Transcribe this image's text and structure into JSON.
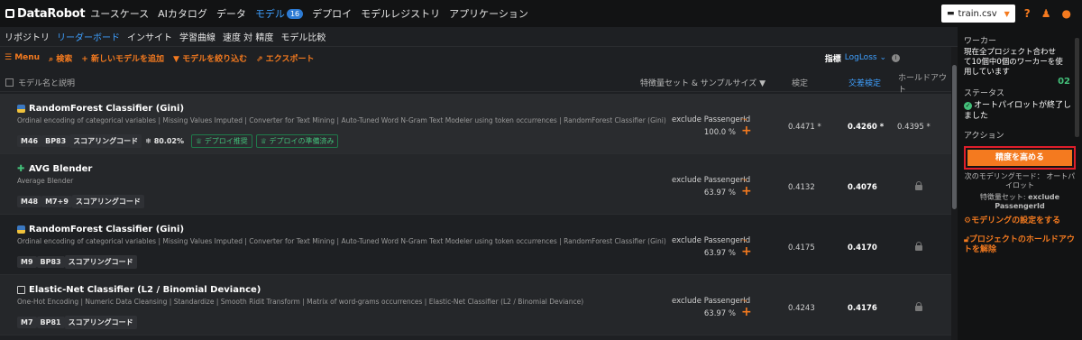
{
  "app": {
    "logo": "DataRobot"
  },
  "nav": {
    "items": [
      {
        "label": "ユースケース"
      },
      {
        "label": "AIカタログ"
      },
      {
        "label": "データ"
      },
      {
        "label": "モデル",
        "badge": "16",
        "active": true
      },
      {
        "label": "デプロイ"
      },
      {
        "label": "モデルレジストリ"
      },
      {
        "label": "アプリケーション"
      }
    ],
    "file": "train.csv",
    "help_icon": "?",
    "notify_icon": "bell-icon",
    "user_icon": "user-icon"
  },
  "subnav": {
    "items": [
      "リポジトリ",
      "リーダーボード",
      "インサイト",
      "学習曲線",
      "速度 対 精度",
      "モデル比較"
    ],
    "active_index": 1
  },
  "toolbar": {
    "menu": "Menu",
    "search": "検索",
    "add_model": "新しいモデルを追加",
    "filter": "モデルを絞り込む",
    "export": "エクスポート",
    "metric_label": "指標",
    "metric_value": "LogLoss"
  },
  "table": {
    "headers": {
      "name": "モデル名と説明",
      "features": "特徴量セット & サンプルサイズ",
      "validation": "検定",
      "cv": "交差検定",
      "holdout": "ホールドアウト"
    },
    "rows": [
      {
        "name": "RandomForest Classifier (Gini)",
        "desc": "Ordinal encoding of categorical variables | Missing Values Imputed | Converter for Text Mining | Auto-Tuned Word N-Gram Text Modeler using token occurrences | RandomForest Classifier (Gini)",
        "tags": [
          "M46",
          "BP83",
          "スコアリングコード"
        ],
        "pct": "80.02%",
        "green_tags": [
          "デプロイ推奨",
          "デプロイの準備済み"
        ],
        "features": "exclude PassengerId",
        "sample": "100.0 %",
        "validation": "0.4471",
        "cv": "0.4260",
        "holdout": "0.4395"
      },
      {
        "name": "AVG Blender",
        "desc": "Average Blender",
        "tags": [
          "M48",
          "M7+9",
          "スコアリングコード"
        ],
        "features": "exclude PassengerId",
        "sample": "63.97 %",
        "validation": "0.4132",
        "cv": "0.4076",
        "holdout": ""
      },
      {
        "name": "RandomForest Classifier (Gini)",
        "desc": "Ordinal encoding of categorical variables | Missing Values Imputed | Converter for Text Mining | Auto-Tuned Word N-Gram Text Modeler using token occurrences | RandomForest Classifier (Gini)",
        "tags": [
          "M9",
          "BP83",
          "スコアリングコード"
        ],
        "features": "exclude PassengerId",
        "sample": "63.97 %",
        "validation": "0.4175",
        "cv": "0.4170",
        "holdout": ""
      },
      {
        "name": "Elastic-Net Classifier (L2 / Binomial Deviance)",
        "desc": "One-Hot Encoding | Numeric Data Cleansing | Standardize | Smooth Ridit Transform | Matrix of word-grams occurrences | Elastic-Net Classifier (L2 / Binomial Deviance)",
        "tags": [
          "M7",
          "BP81",
          "スコアリングコード"
        ],
        "features": "exclude PassengerId",
        "sample": "63.97 %",
        "validation": "0.4243",
        "cv": "0.4176",
        "holdout": ""
      }
    ]
  },
  "panel": {
    "worker_title": "ワーカー",
    "worker_text": "現在全プロジェクト合わせて10個中0個のワーカーを使用しています",
    "worker_count": "02",
    "status_title": "ステータス",
    "status_text": "オートパイロットが終了しました",
    "action_title": "アクション",
    "action_button": "精度を高める",
    "next_mode": "次のモデリングモード： オートパイロット",
    "feature_set_label": "特徴量セット:",
    "feature_set": "exclude PassengerId",
    "modeling_settings": "モデリングの設定をする",
    "unlock_holdout": "プロジェクトのホールドアウトを解除"
  }
}
